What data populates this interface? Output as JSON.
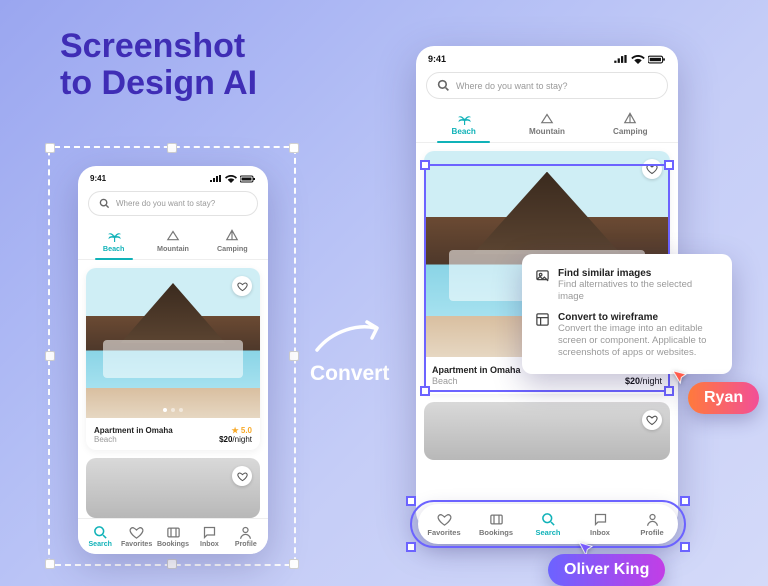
{
  "marketing": {
    "title_line1": "Screenshot",
    "title_line2": "to Design AI",
    "convert_label": "Convert"
  },
  "phone": {
    "time": "9:41",
    "search_placeholder": "Where do you want to stay?",
    "tabs": [
      {
        "icon": "palm-icon",
        "label": "Beach",
        "active": true
      },
      {
        "icon": "mountain-icon",
        "label": "Mountain",
        "active": false
      },
      {
        "icon": "tent-icon",
        "label": "Camping",
        "active": false
      }
    ],
    "listing": {
      "title": "Apartment in Omaha",
      "rating_star": "★",
      "rating": "5.0",
      "category": "Beach",
      "price": "$20",
      "per": "/night"
    },
    "nav_left": [
      {
        "icon": "search-icon",
        "label": "Search",
        "active": true
      },
      {
        "icon": "heart-icon",
        "label": "Favorites"
      },
      {
        "icon": "tickets-icon",
        "label": "Bookings"
      },
      {
        "icon": "chat-icon",
        "label": "Inbox"
      },
      {
        "icon": "profile-icon",
        "label": "Profile"
      }
    ],
    "nav_right": [
      {
        "icon": "heart-icon",
        "label": "Favorites"
      },
      {
        "icon": "tickets-icon",
        "label": "Bookings"
      },
      {
        "icon": "search-icon",
        "label": "Search",
        "active": true
      },
      {
        "icon": "chat-icon",
        "label": "Inbox"
      },
      {
        "icon": "profile-icon",
        "label": "Profile"
      }
    ]
  },
  "context_menu": {
    "items": [
      {
        "icon": "image-search-icon",
        "title": "Find similar images",
        "sub": "Find alternatives to the selected image"
      },
      {
        "icon": "wireframe-icon",
        "title": "Convert to wireframe",
        "sub": "Convert the image into an editable screen or component. Applicable to screenshots of apps or websites."
      }
    ]
  },
  "collaborators": {
    "ryan": "Ryan",
    "oliver": "Oliver King"
  }
}
